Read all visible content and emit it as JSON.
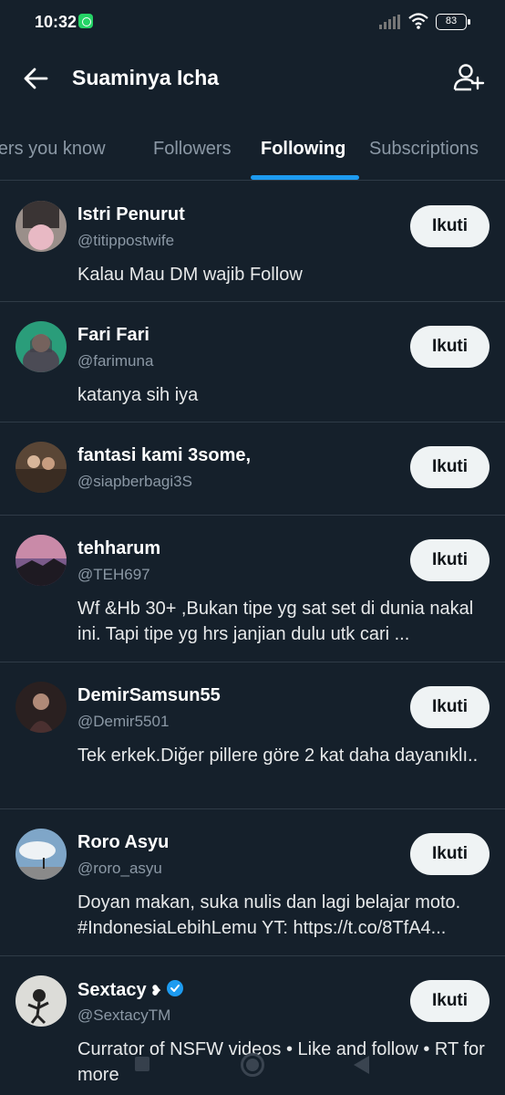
{
  "status_bar": {
    "time": "10:32",
    "battery": "83"
  },
  "header": {
    "title": "Suaminya Icha"
  },
  "tabs": [
    {
      "label": "Followers you know"
    },
    {
      "label": "Followers"
    },
    {
      "label": "Following"
    },
    {
      "label": "Subscriptions"
    }
  ],
  "active_tab": "Following",
  "accent_color": "#1d9bf0",
  "users": [
    {
      "name": "Istri Penurut",
      "handle": "@titippostwife",
      "bio": "Kalau Mau DM wajib Follow",
      "follow_label": "Ikuti"
    },
    {
      "name": "Fari Fari",
      "handle": "@farimuna",
      "bio": "katanya sih iya",
      "follow_label": "Ikuti"
    },
    {
      "name": "fantasi kami 3some,",
      "handle": "@siapberbagi3S",
      "bio": "",
      "follow_label": "Ikuti"
    },
    {
      "name": "tehharum",
      "handle": "@TEH697",
      "bio": "Wf &Hb 30+ ,Bukan tipe yg sat set di dunia nakal ini. Tapi tipe yg hrs janjian dulu utk cari ...",
      "follow_label": "Ikuti"
    },
    {
      "name": "DemirSamsun55",
      "handle": "@Demir5501",
      "bio": "Tek erkek.Diğer pillere göre 2 kat daha dayanıklı..",
      "follow_label": "Ikuti"
    },
    {
      "name": "Roro Asyu",
      "handle": "@roro_asyu",
      "bio": "Doyan makan, suka nulis dan lagi belajar moto. #IndonesiaLebihLemu YT: https://t.co/8TfA4...",
      "follow_label": "Ikuti"
    },
    {
      "name": "Sextacy",
      "handle": "@SextacyTM",
      "bio": "Currator of NSFW videos • Like and follow • RT for more",
      "follow_label": "Ikuti",
      "name_suffix": "❥",
      "verified": true
    }
  ]
}
